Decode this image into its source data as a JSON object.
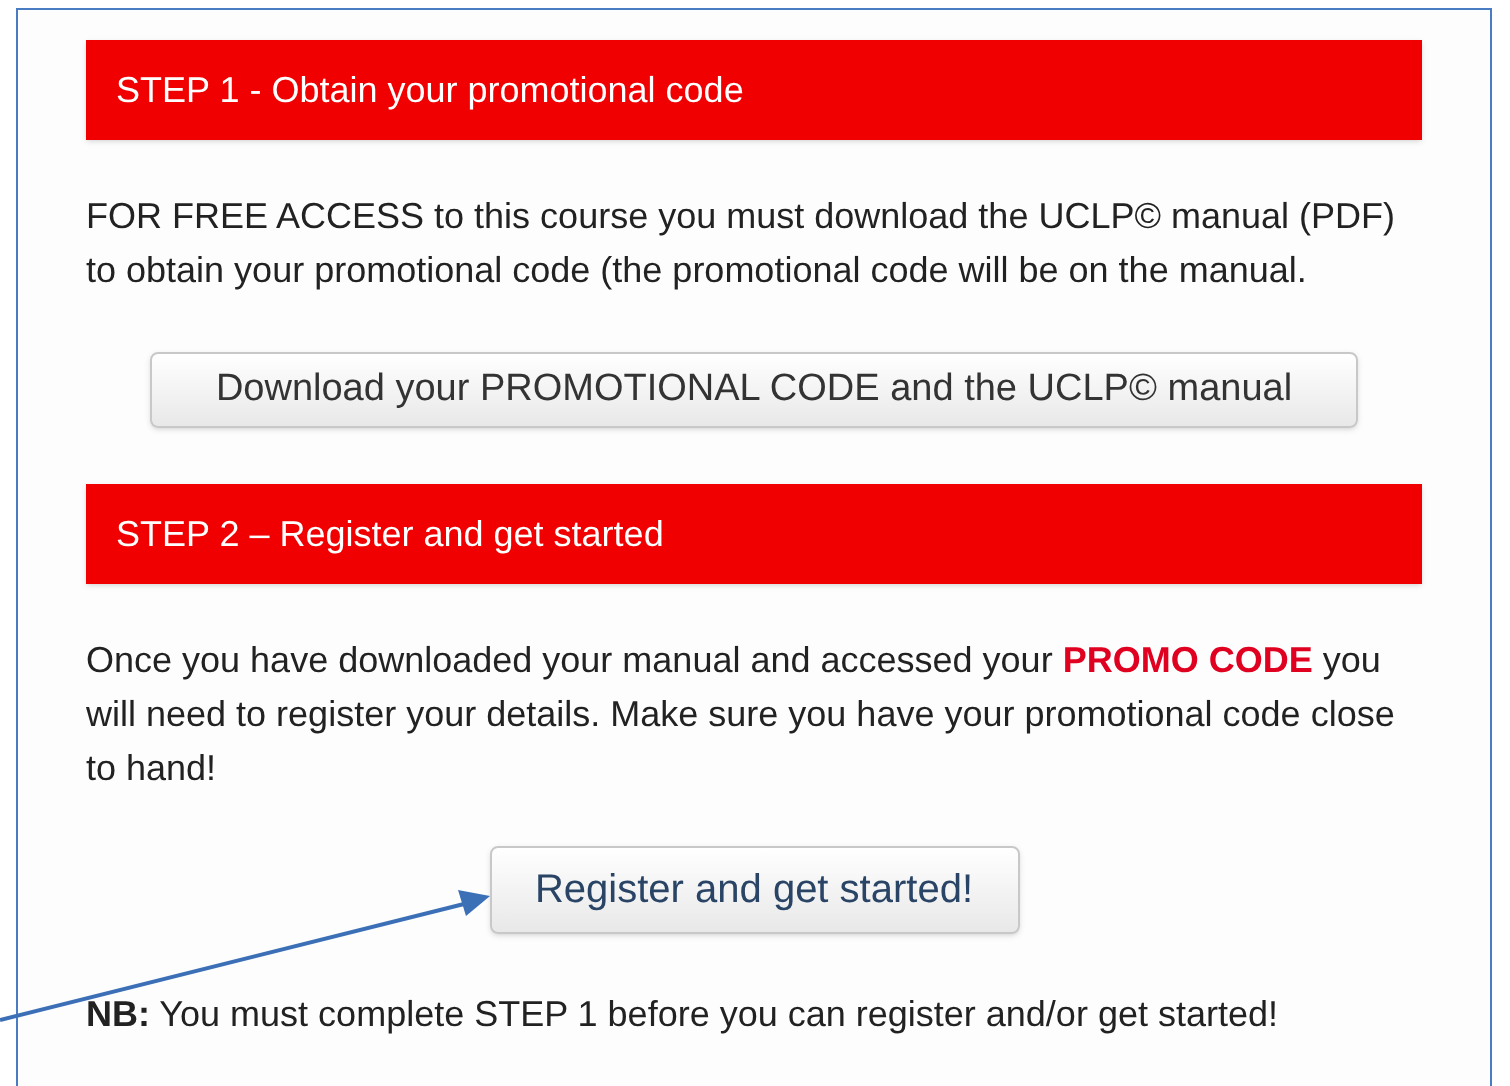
{
  "steps": [
    {
      "heading": "STEP 1 - Obtain your promotional code",
      "paragraph": [
        {
          "text": "FOR FREE ACCESS to this course you must download the UCLP© manual (PDF) to obtain your promotional code (the promotional code will be on the manual.",
          "highlight": false
        }
      ],
      "button": {
        "label": "Download your PROMOTIONAL CODE and the UCLP© manual",
        "kind": "wide"
      }
    },
    {
      "heading": "STEP 2  – Register and get started",
      "paragraph": [
        {
          "text": "Once you have downloaded your manual and accessed your ",
          "highlight": false
        },
        {
          "text": "PROMO CODE",
          "highlight": true
        },
        {
          "text": " you will need to register your details. Make sure you have your promotional code close to hand!",
          "highlight": false
        }
      ],
      "button": {
        "label": "Register and get started!",
        "kind": "compact"
      }
    }
  ],
  "note": "**NB:** You must complete STEP 1 before you can register and/or get started!"
}
